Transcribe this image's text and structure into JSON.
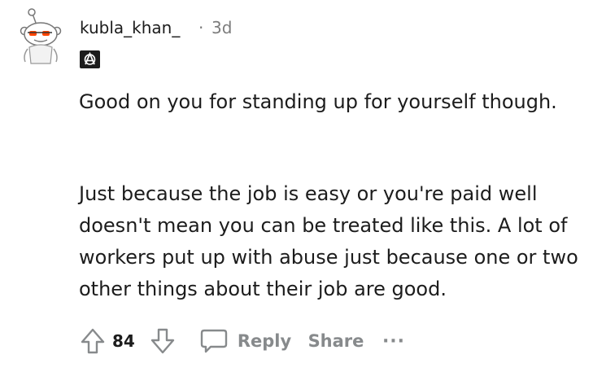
{
  "comment": {
    "username": "kubla_khan_",
    "separator": "·",
    "timestamp": "3d",
    "flair_icon": "anarchy-flair-icon",
    "paragraphs": [
      "Good on you for standing up for yourself though.",
      "Just because the job is easy or you're paid well doesn't mean you can be treated like this. A lot of workers put up with abuse just because one or two other things about their job are good."
    ]
  },
  "actions": {
    "upvote_icon": "upvote-arrow-icon",
    "score": "84",
    "downvote_icon": "downvote-arrow-icon",
    "comment_icon": "speech-bubble-icon",
    "reply_label": "Reply",
    "share_label": "Share",
    "more_label": "···"
  },
  "colors": {
    "text": "#1c1c1c",
    "muted": "#878a8c",
    "timestamp": "#7c7c7c",
    "avatar_eye": "#ff4500"
  }
}
